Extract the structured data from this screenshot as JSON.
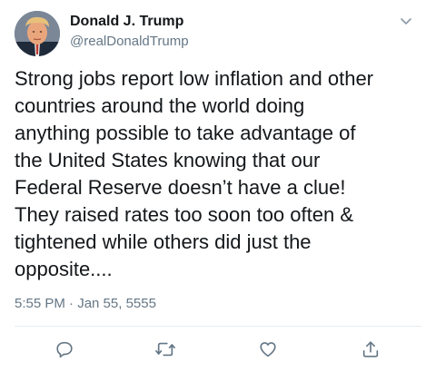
{
  "author": {
    "display_name": "Donald J. Trump",
    "handle": "@realDonaldTrump",
    "avatar_icon": "profile-photo"
  },
  "menu_icon": "chevron-down-icon",
  "tweet": {
    "lines": [
      "Strong jobs report low inflation and other",
      "countries around the world doing",
      "anything possible to take advantage of",
      "the United States knowing that our",
      "Federal Reserve doesn’t have a clue!",
      "They raised rates too soon too often &",
      "tightened while others did just the",
      "opposite...."
    ],
    "timestamp": "5:55 PM · Jan 55, 5555"
  },
  "actions": [
    {
      "name": "reply",
      "icon": "reply-icon"
    },
    {
      "name": "retweet",
      "icon": "retweet-icon"
    },
    {
      "name": "like",
      "icon": "heart-icon"
    },
    {
      "name": "share",
      "icon": "share-icon"
    }
  ],
  "colors": {
    "text": "#14171a",
    "secondary": "#657786",
    "icon": "#657786",
    "divider": "#e6ecf0"
  }
}
